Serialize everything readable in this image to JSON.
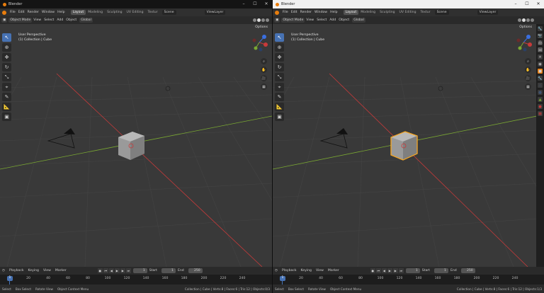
{
  "left": {
    "title": "Blender",
    "menu": [
      "File",
      "Edit",
      "Render",
      "Window",
      "Help"
    ],
    "tabs": [
      "Layout",
      "Modeling",
      "Sculpting",
      "UV Editing",
      "Textur"
    ],
    "scene": "Scene",
    "viewlayer": "ViewLayer",
    "header": {
      "mode": "Object Mode",
      "view": "View",
      "select": "Select",
      "add": "Add",
      "object": "Object",
      "orient": "Global"
    },
    "options": "Options",
    "info": [
      "User Perspective",
      "(1) Collection | Cube"
    ],
    "timeline": {
      "playback": "Playback",
      "keying": "Keying",
      "view": "View",
      "marker": "Marker",
      "frame": "1",
      "start_label": "Start",
      "start": "1",
      "end_label": "End",
      "end": "250"
    },
    "ruler": [
      "1",
      "20",
      "40",
      "60",
      "80",
      "100",
      "120",
      "140",
      "160",
      "180",
      "200",
      "220",
      "240"
    ],
    "status": {
      "select": "Select",
      "box": "Box Select",
      "rotate": "Rotate View",
      "ctx": "Object Context Menu",
      "stats": "Collection | Cube | Verts:8 | Faces:6 | Tris:12 | Objects:0/3"
    }
  },
  "right": {
    "title": "Blender",
    "menu": [
      "File",
      "Edit",
      "Render",
      "Window",
      "Help"
    ],
    "tabs": [
      "Layout",
      "Modeling",
      "Sculpting",
      "UV Editing",
      "Textur"
    ],
    "scene": "Scene",
    "viewlayer": "ViewLayer",
    "header": {
      "mode": "Object Mode",
      "view": "View",
      "select": "Select",
      "add": "Add",
      "object": "Object",
      "orient": "Global"
    },
    "options": "Options",
    "info": [
      "User Perspective",
      "(1) Collection | Cube"
    ],
    "timeline": {
      "playback": "Playback",
      "keying": "Keying",
      "view": "View",
      "marker": "Marker",
      "frame": "1",
      "start_label": "Start",
      "start": "1",
      "end_label": "End",
      "end": "250"
    },
    "ruler": [
      "1",
      "20",
      "40",
      "60",
      "80",
      "100",
      "120",
      "140",
      "160",
      "180",
      "200",
      "220",
      "240"
    ],
    "status": {
      "select": "Select",
      "box": "Box Select",
      "rotate": "Rotate View",
      "ctx": "Object Context Menu",
      "stats": "Collection | Cube | Verts:8 | Faces:6 | Tris:12 | Objects:1/3"
    }
  },
  "window_controls": [
    "–",
    "☐",
    "✕"
  ],
  "icons": {
    "cursor": "select-cursor-icon",
    "move": "move-icon",
    "rotate": "rotate-icon",
    "scale": "scale-icon"
  },
  "colors": {
    "accent": "#4772b3",
    "orange": "#e87d0d",
    "x_axis": "#c83a3a",
    "y_axis": "#7aa832",
    "selection": "#f5a623"
  }
}
